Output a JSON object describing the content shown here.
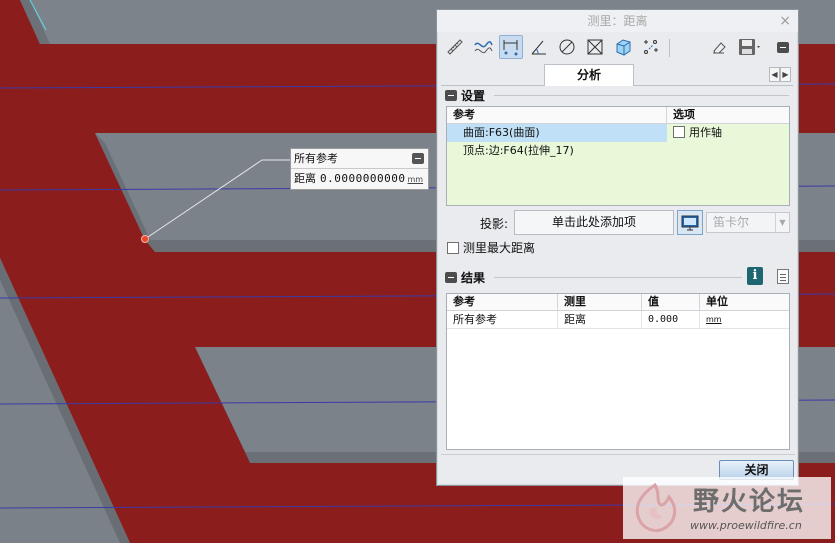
{
  "callout": {
    "title": "所有参考",
    "label": "距离",
    "value": "0.0000000000",
    "unit": "mm"
  },
  "dialog": {
    "title": "测里：距离",
    "close_glyph": "×",
    "toolbar_icons": [
      "ruler-icon",
      "curve-length-icon",
      "distance-icon",
      "angle-icon",
      "diameter-icon",
      "area-icon",
      "volume-icon",
      "transform-icon",
      "eraser-icon",
      "save-icon",
      "collapse-icon"
    ],
    "tab": "分析",
    "settings": {
      "heading": "设置",
      "columns": [
        "参考",
        "选项"
      ],
      "rows": [
        {
          "ref": "曲面:F63(曲面)",
          "option": "用作轴",
          "selected": true
        },
        {
          "ref": "顶点:边:F64(拉伸_17)",
          "option": "",
          "selected": false
        }
      ],
      "projection_label": "投影:",
      "projection_value": "单击此处添加项",
      "coord_select": "笛卡尔",
      "max_distance_label": "测里最大距离"
    },
    "results": {
      "heading": "结果",
      "columns": [
        "参考",
        "测里",
        "值",
        "单位"
      ],
      "rows": [
        {
          "ref": "所有参考",
          "measure": "距离",
          "value": "0.000",
          "unit": "mm"
        }
      ]
    },
    "close_button": "关闭"
  },
  "watermark": {
    "title": "野火论坛",
    "url": "www.proewildfire.cn"
  },
  "colors": {
    "model_red": "#8c1d1d",
    "surface_gray": "#7a8087",
    "selection_blue": "#bfe0f7",
    "reference_green": "#e8f8d8"
  }
}
